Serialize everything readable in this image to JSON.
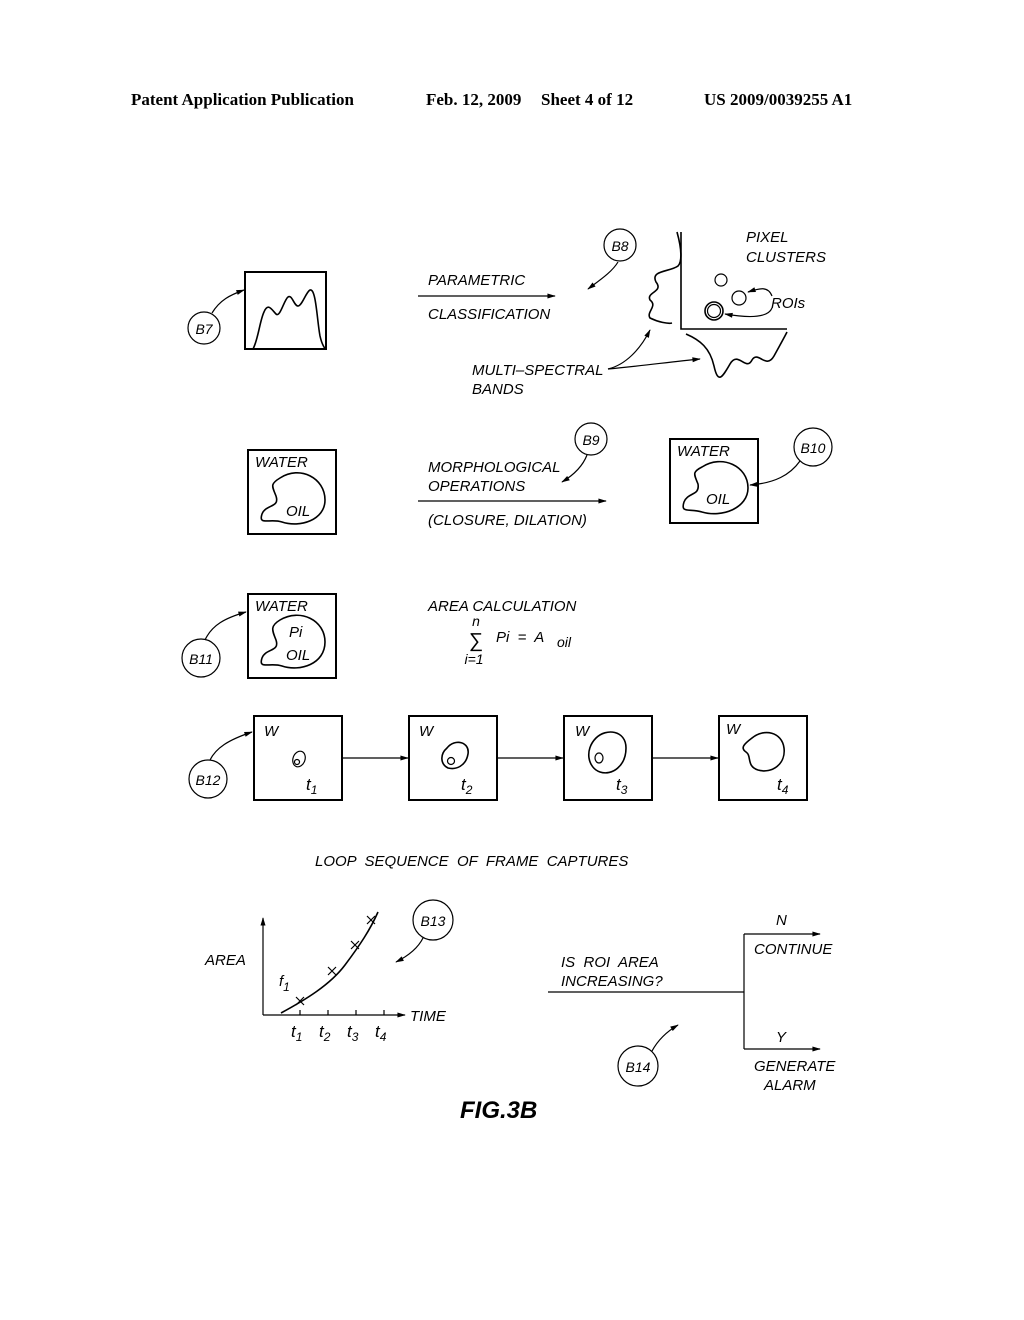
{
  "header": {
    "publication": "Patent Application Publication",
    "date": "Feb. 12, 2009",
    "sheet": "Sheet 4 of 12",
    "number": "US 2009/0039255 A1"
  },
  "figure_label": "FIG.3B",
  "step_b7": {
    "ref": "B7",
    "arrow_top": "PARAMETRIC",
    "arrow_bottom": "CLASSIFICATION"
  },
  "step_b8": {
    "ref": "B8",
    "pixel_clusters": [
      "PIXEL",
      "CLUSTERS"
    ],
    "rois": "ROIs",
    "bands": [
      "MULTI–SPECTRAL",
      "BANDS"
    ]
  },
  "step_b9": {
    "ref": "B9",
    "input_box": {
      "water": "WATER",
      "oil": "OIL"
    },
    "arrow_top": [
      "MORPHOLOGICAL",
      "OPERATIONS"
    ],
    "arrow_bottom": "(CLOSURE,  DILATION)"
  },
  "step_b10": {
    "ref": "B10",
    "box": {
      "water": "WATER",
      "oil": "OIL"
    }
  },
  "step_b11": {
    "ref": "B11",
    "box": {
      "water": "WATER",
      "pi": "Pi",
      "oil": "OIL"
    },
    "title": "AREA  CALCULATION",
    "sum_upper": "n",
    "sum_symbol": "∑",
    "sum_lower": "i=1",
    "formula_rhs": "Pi  =  A",
    "formula_sub": "oil"
  },
  "step_b12": {
    "ref": "B12",
    "frames": [
      {
        "w": "W",
        "t": "t",
        "sub": "1"
      },
      {
        "w": "W",
        "t": "t",
        "sub": "2"
      },
      {
        "w": "W",
        "t": "t",
        "sub": "3"
      },
      {
        "w": "W",
        "t": "t",
        "sub": "4"
      }
    ],
    "caption": "LOOP  SEQUENCE  OF  FRAME  CAPTURES"
  },
  "step_b13": {
    "ref": "B13",
    "ylabel": "AREA",
    "xlabel": "TIME",
    "curve": "f",
    "curve_sub": "1",
    "ticks": [
      {
        "t": "t",
        "sub": "1"
      },
      {
        "t": "t",
        "sub": "2"
      },
      {
        "t": "t",
        "sub": "3"
      },
      {
        "t": "t",
        "sub": "4"
      }
    ]
  },
  "step_b14": {
    "ref": "B14",
    "question": [
      "IS  ROI  AREA",
      "INCREASING?"
    ],
    "no_label": "N",
    "no_action": "CONTINUE",
    "yes_label": "Y",
    "yes_action": [
      "GENERATE",
      "ALARM"
    ]
  }
}
